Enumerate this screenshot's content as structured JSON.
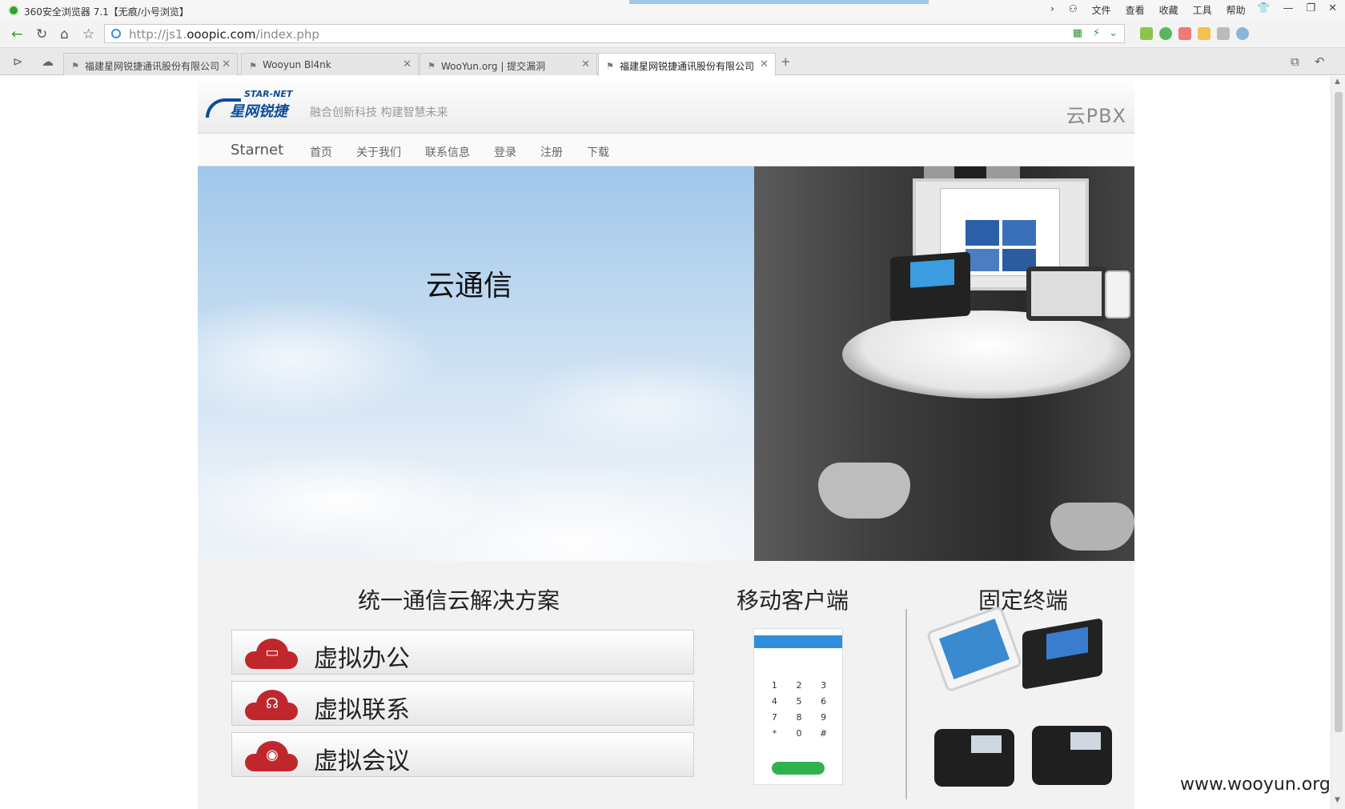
{
  "browser": {
    "title": "360安全浏览器 7.1【无痕/小号浏览】",
    "menu": [
      "文件",
      "查看",
      "收藏",
      "工具",
      "帮助"
    ],
    "url_prefix": "http://js1.",
    "url_domain": "ooopic.com",
    "url_path": "/index.php",
    "tabs": [
      {
        "label": "福建星网锐捷通讯股份有限公司",
        "active": false
      },
      {
        "label": "Wooyun Bl4nk",
        "active": false
      },
      {
        "label": "WooYun.org | 提交漏洞",
        "active": false
      },
      {
        "label": "福建星网锐捷通讯股份有限公司",
        "active": true
      }
    ],
    "new_tab": "+"
  },
  "site": {
    "logo_en": "STAR-NET",
    "logo_cn": "星网锐捷",
    "slogan": "融合创新科技 构建智慧未来",
    "product_mark": "云PBX",
    "nav_brand": "Starnet",
    "nav_items": [
      "首页",
      "关于我们",
      "联系信息",
      "登录",
      "注册",
      "下载"
    ],
    "hero_title": "云通信",
    "solutions_title": "统一通信云解决方案",
    "solutions": [
      {
        "label": "虚拟办公",
        "glyph": "laptop-icon"
      },
      {
        "label": "虚拟联系",
        "glyph": "headset-icon"
      },
      {
        "label": "虚拟会议",
        "glyph": "webcam-icon"
      }
    ],
    "mobile_title": "移动客户端",
    "terminal_title": "固定终端",
    "keypad": [
      "1",
      "2",
      "3",
      "4",
      "5",
      "6",
      "7",
      "8",
      "9",
      "*",
      "0",
      "#"
    ]
  },
  "watermark": "www.wooyun.org",
  "colors": {
    "brand_blue": "#0d4c9a",
    "accent_red": "#c0272d",
    "browser_green": "#2fa331"
  }
}
